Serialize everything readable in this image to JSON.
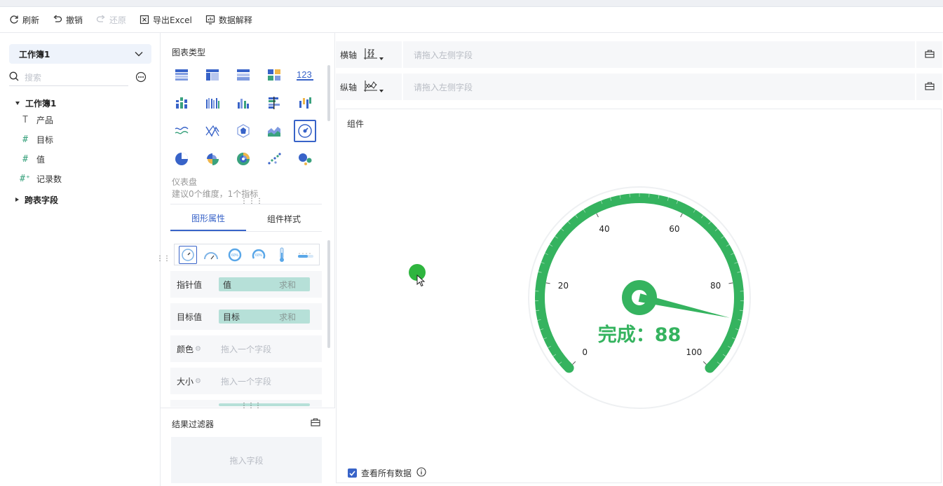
{
  "toolbar": {
    "refresh": "刷新",
    "undo": "撤销",
    "redo": "还原",
    "export": "导出Excel",
    "explain": "数据解释"
  },
  "left": {
    "workbook_select": "工作簿1",
    "search_placeholder": "搜索",
    "tree_root": "工作簿1",
    "fields": [
      {
        "icon": "text-type-icon",
        "name": "产品"
      },
      {
        "icon": "number-type-icon",
        "name": "目标"
      },
      {
        "icon": "number-type-icon",
        "name": "值"
      },
      {
        "icon": "count-type-icon",
        "name": "记录数"
      }
    ],
    "cross_table": "跨表字段"
  },
  "middle": {
    "chart_type_title": "图表类型",
    "chart_types": [
      "table",
      "cross-table",
      "detail-table",
      "kpi-card",
      "number-123",
      "stacked-bar",
      "grouped-bar",
      "bar",
      "horizontal-bar",
      "range-bar",
      "line-wave",
      "crossing-lines",
      "radar",
      "area",
      "gauge",
      "pie",
      "rose-pie",
      "multi-pie",
      "scatter",
      "bubble"
    ],
    "selected_chart_type": "gauge",
    "selected_name": "仪表盘",
    "selected_hint": "建议0个维度，1个指标",
    "tabs": [
      "图形属性",
      "组件样式"
    ],
    "active_tab": "图形属性",
    "gauge_styles": [
      "gauge-style-1",
      "gauge-style-2",
      "gauge-style-3",
      "gauge-style-4",
      "thermometer",
      "slot"
    ],
    "properties": [
      {
        "label": "指针值",
        "field": "值",
        "agg": "求和"
      },
      {
        "label": "目标值",
        "field": "目标",
        "agg": "求和"
      },
      {
        "label": "颜色",
        "placeholder": "拖入一个字段"
      },
      {
        "label": "大小",
        "placeholder": "拖入一个字段"
      }
    ],
    "filter_title": "结果过滤器",
    "filter_placeholder": "拖入字段"
  },
  "axes": {
    "x_label": "横轴",
    "y_label": "纵轴",
    "placeholder": "请拖入左侧字段"
  },
  "canvas": {
    "title": "组件",
    "show_all_label": "查看所有数据",
    "show_all_checked": true
  },
  "gauge": {
    "value": 88,
    "min": 0,
    "max": 100,
    "ticks": [
      "0",
      "20",
      "40",
      "60",
      "80",
      "100"
    ],
    "label_text": "完成：88",
    "color": "#35b35f"
  }
}
